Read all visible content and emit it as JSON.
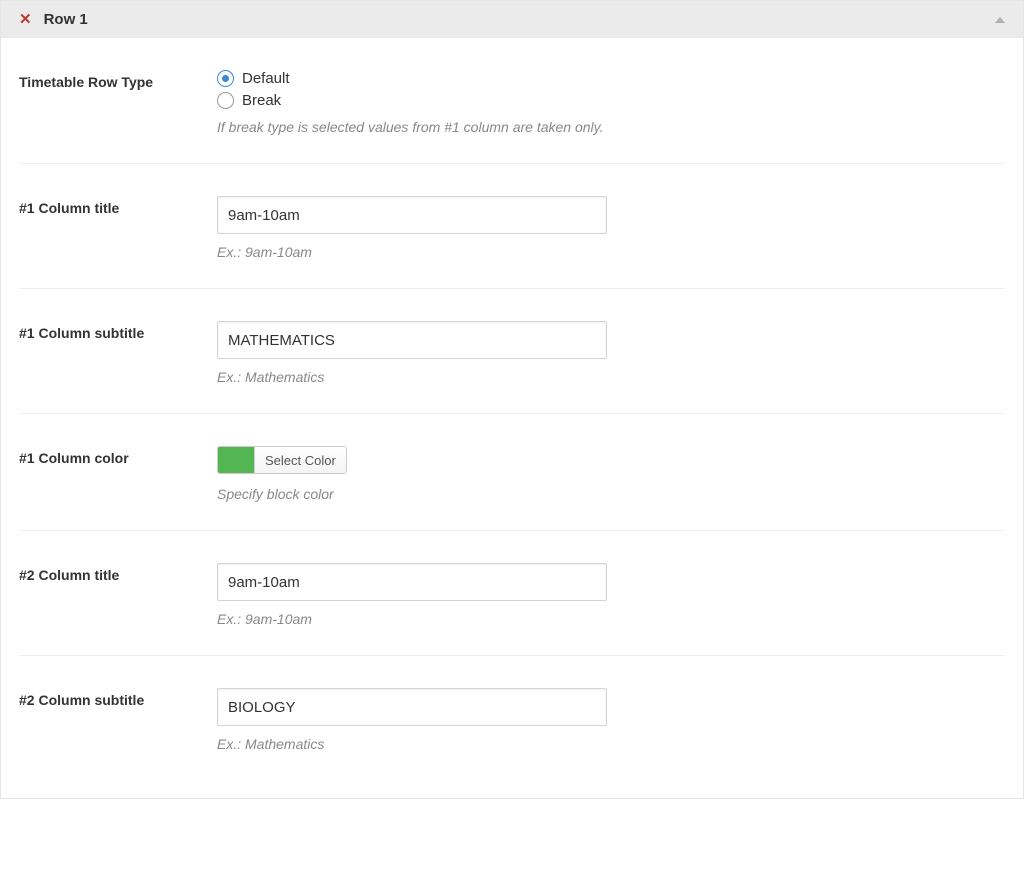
{
  "header": {
    "title": "Row 1"
  },
  "rowType": {
    "label": "Timetable Row Type",
    "options": [
      {
        "label": "Default",
        "selected": true
      },
      {
        "label": "Break",
        "selected": false
      }
    ],
    "helper": "If break type is selected values from #1 column are taken only."
  },
  "fields": {
    "col1Title": {
      "label": "#1 Column title",
      "value": "9am-10am",
      "helper": "Ex.: 9am-10am"
    },
    "col1Subtitle": {
      "label": "#1 Column subtitle",
      "value": "MATHEMATICS",
      "helper": "Ex.: Mathematics"
    },
    "col1Color": {
      "label": "#1 Column color",
      "buttonLabel": "Select Color",
      "swatch": "#53b653",
      "helper": "Specify block color"
    },
    "col2Title": {
      "label": "#2 Column title",
      "value": "9am-10am",
      "helper": "Ex.: 9am-10am"
    },
    "col2Subtitle": {
      "label": "#2 Column subtitle",
      "value": "BIOLOGY",
      "helper": "Ex.: Mathematics"
    }
  }
}
